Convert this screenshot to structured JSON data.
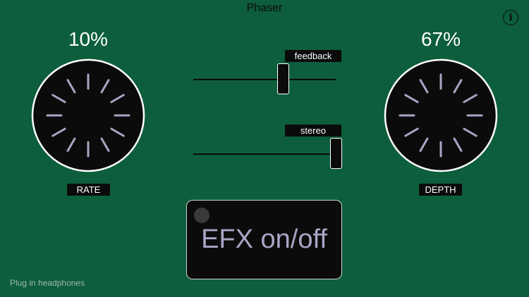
{
  "header": {
    "title": "Phaser"
  },
  "info_button": {
    "icon": "info-icon",
    "glyph": "i"
  },
  "rate_knob": {
    "value_text": "10%",
    "label": "RATE",
    "value_percent": 10
  },
  "depth_knob": {
    "value_text": "67%",
    "label": "DEPTH",
    "value_percent": 67
  },
  "feedback_slider": {
    "label": "feedback",
    "value_fraction": 0.63
  },
  "stereo_slider": {
    "label": "stereo",
    "value_fraction": 1.0
  },
  "efx_button": {
    "label": "EFX on/off",
    "state": "off"
  },
  "status": {
    "text": "Plug in headphones"
  },
  "colors": {
    "background": "#0d5e3c",
    "control": "#0b0b0b",
    "knob_tick": "#a8a6c6",
    "text": "#ffffff"
  }
}
